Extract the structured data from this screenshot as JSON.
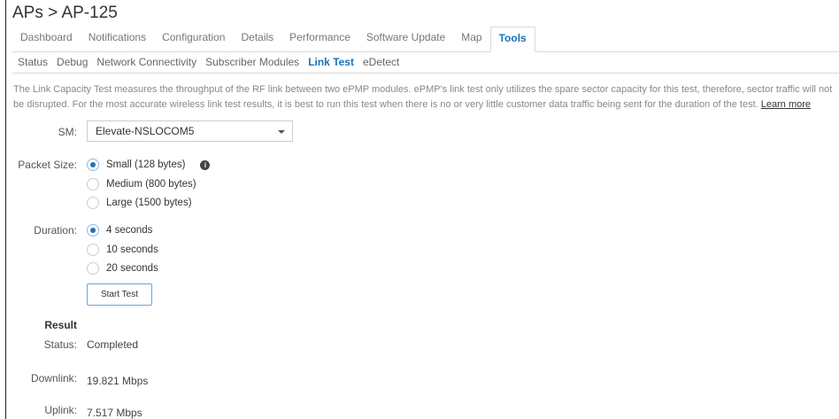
{
  "breadcrumb": "APs > AP-125",
  "tabs": [
    {
      "label": "Dashboard"
    },
    {
      "label": "Notifications"
    },
    {
      "label": "Configuration"
    },
    {
      "label": "Details"
    },
    {
      "label": "Performance"
    },
    {
      "label": "Software Update"
    },
    {
      "label": "Map"
    },
    {
      "label": "Tools"
    }
  ],
  "active_tab": "Tools",
  "subtabs": [
    {
      "label": "Status"
    },
    {
      "label": "Debug"
    },
    {
      "label": "Network Connectivity"
    },
    {
      "label": "Subscriber Modules"
    },
    {
      "label": "Link Test"
    },
    {
      "label": "eDetect"
    }
  ],
  "active_subtab": "Link Test",
  "description": "The Link Capacity Test measures the throughput of the RF link between two ePMP modules. ePMP's link test only utilizes the spare sector capacity for this test, therefore, sector traffic will not be disrupted. For the most accurate wireless link test results, it is best to run this test when there is no or very little customer data traffic being sent for the duration of the test.",
  "learn_more": "Learn more",
  "sm": {
    "label": "SM:",
    "value": "Elevate-NSLOCOM5"
  },
  "packet_size": {
    "label": "Packet Size:",
    "options": [
      "Small (128 bytes)",
      "Medium (800 bytes)",
      "Large (1500 bytes)"
    ],
    "selected": 0
  },
  "duration": {
    "label": "Duration:",
    "options": [
      "4 seconds",
      "10 seconds",
      "20 seconds"
    ],
    "selected": 0
  },
  "start_button": "Start Test",
  "result": {
    "title": "Result",
    "status_label": "Status:",
    "status_value": "Completed",
    "downlink_label": "Downlink:",
    "downlink_value": "19.821 Mbps",
    "uplink_label": "Uplink:",
    "uplink_value": "7.517 Mbps"
  },
  "colors": {
    "accent": "#1a73b8",
    "muted_text": "#888888"
  }
}
